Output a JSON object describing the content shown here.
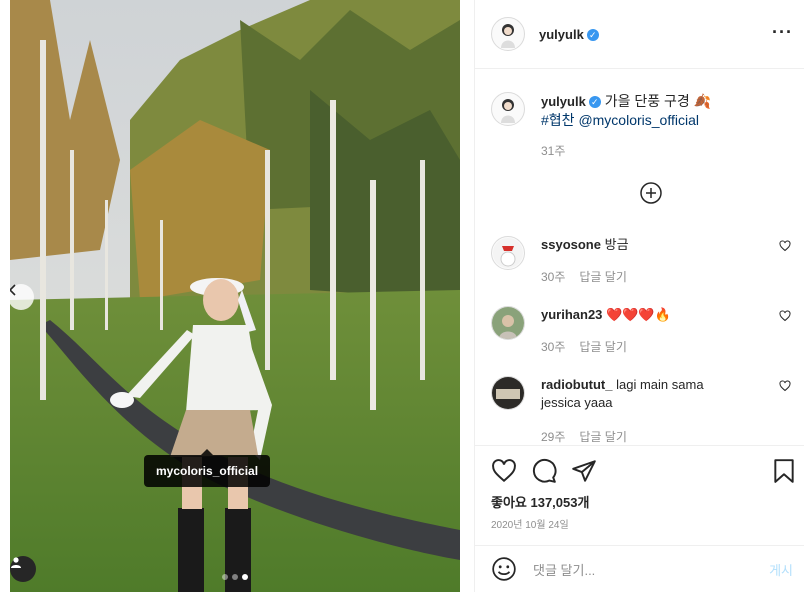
{
  "post": {
    "author": "yulyulk",
    "verified_badge": "✓",
    "caption": "가을 단풍 구경 🍂",
    "caption_hashtag": "#협찬",
    "caption_mention": "@mycoloris_official",
    "caption_time": "31주",
    "tag_label": "mycoloris_official",
    "carousel_active_index": 3,
    "carousel_count": 3
  },
  "comments": [
    {
      "user": "ssyosone",
      "text": "방금",
      "time": "30주",
      "reply": "답글 달기"
    },
    {
      "user": "yurihan23",
      "text": "❤️❤️❤️🔥",
      "time": "30주",
      "reply": "답글 달기"
    },
    {
      "user": "radiobutut_",
      "text": "lagi main sama jessica yaaa",
      "time": "29주",
      "reply": "답글 달기"
    }
  ],
  "stats": {
    "likes": "좋아요 137,053개",
    "date": "2020년 10월 24일"
  },
  "composer": {
    "placeholder": "댓글 달기...",
    "post_label": "게시"
  },
  "icons": {
    "more": "more-horizontal-icon",
    "plus": "plus-circle-icon",
    "like": "heart-icon",
    "comment": "comment-icon",
    "share": "share-icon",
    "save": "bookmark-icon",
    "emoji": "emoji-icon"
  },
  "colors": {
    "verified": "#3897f0",
    "link": "#00376b",
    "muted": "#8e8e8e",
    "post_disabled": "#b2dffc"
  }
}
